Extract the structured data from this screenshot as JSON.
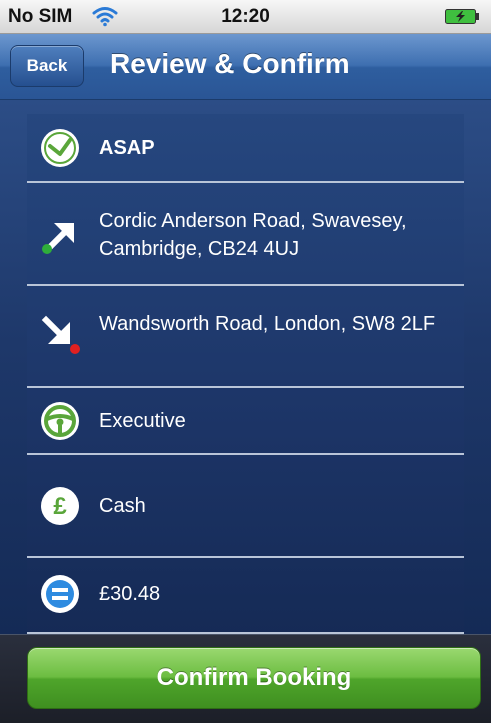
{
  "status_bar": {
    "carrier": "No SIM",
    "time": "12:20",
    "wifi_icon": "wifi-icon",
    "battery_icon": "battery-charging-icon"
  },
  "nav": {
    "back_label": "Back",
    "title": "Review & Confirm"
  },
  "rows": [
    {
      "icon": "clock-icon",
      "text": "ASAP"
    },
    {
      "icon": "pickup-arrow-icon",
      "text": "Cordic Anderson Road, Swavesey, Cambridge, CB24 4UJ"
    },
    {
      "icon": "dropoff-arrow-icon",
      "text": "Wandsworth Road, London, SW8 2LF"
    },
    {
      "icon": "steering-wheel-icon",
      "text": "Executive"
    },
    {
      "icon": "pound-icon",
      "text": "Cash"
    },
    {
      "icon": "equals-icon",
      "text": "£30.48"
    }
  ],
  "confirm_label": "Confirm Booking",
  "colors": {
    "nav_blue": "#3e6fb0",
    "confirm_green": "#5cb036",
    "icon_green": "#5aa63a",
    "pickup_dot": "#2fae3a",
    "dropoff_dot": "#e02020",
    "equals_blue": "#2e8be0"
  }
}
